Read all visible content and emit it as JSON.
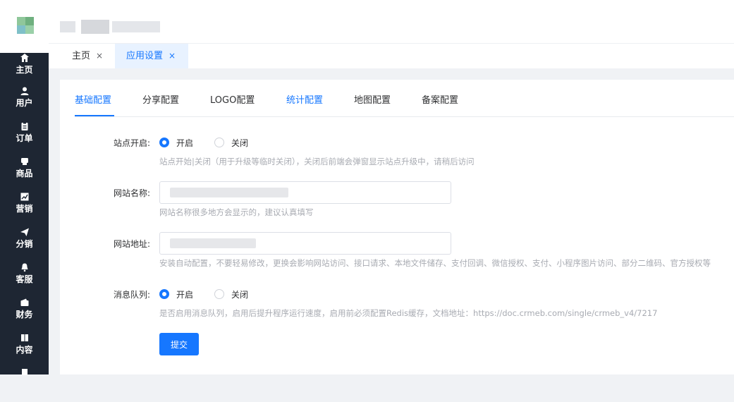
{
  "sidebar": {
    "items": [
      {
        "label": "主页",
        "icon": "home-icon"
      },
      {
        "label": "用户",
        "icon": "user-icon"
      },
      {
        "label": "订单",
        "icon": "clipboard-icon"
      },
      {
        "label": "商品",
        "icon": "box-icon"
      },
      {
        "label": "营销",
        "icon": "chart-icon"
      },
      {
        "label": "分销",
        "icon": "send-icon"
      },
      {
        "label": "客服",
        "icon": "bell-icon"
      },
      {
        "label": "财务",
        "icon": "wallet-icon"
      },
      {
        "label": "内容",
        "icon": "book-icon"
      }
    ]
  },
  "tabs": [
    {
      "label": "主页",
      "close": "×"
    },
    {
      "label": "应用设置",
      "close": "×"
    }
  ],
  "config_tabs": [
    "基础配置",
    "分享配置",
    "LOGO配置",
    "统计配置",
    "地图配置",
    "备案配置"
  ],
  "form": {
    "site_open": {
      "label": "站点开启:",
      "options": [
        "开启",
        "关闭"
      ],
      "selected": "开启",
      "help": "站点开始|关闭（用于升级等临时关闭），关闭后前端会弹窗显示站点升级中，请稍后访问"
    },
    "site_name": {
      "label": "网站名称:",
      "help": "网站名称很多地方会显示的，建议认真填写"
    },
    "site_url": {
      "label": "网站地址:",
      "help": "安装自动配置，不要轻易修改，更换会影响网站访问、接口请求、本地文件储存、支付回调、微信授权、支付、小程序图片访问、部分二维码、官方授权等"
    },
    "queue": {
      "label": "消息队列:",
      "options": [
        "开启",
        "关闭"
      ],
      "selected": "开启",
      "help": "是否启用消息队列，启用后提升程序运行速度，启用前必须配置Redis缓存，文档地址：https://doc.crmeb.com/single/crmeb_v4/7217"
    },
    "submit_label": "提交"
  },
  "colors": {
    "accent": "#1677ff",
    "sidebar_bg": "#1e2633",
    "help_text": "#a8abb2"
  }
}
